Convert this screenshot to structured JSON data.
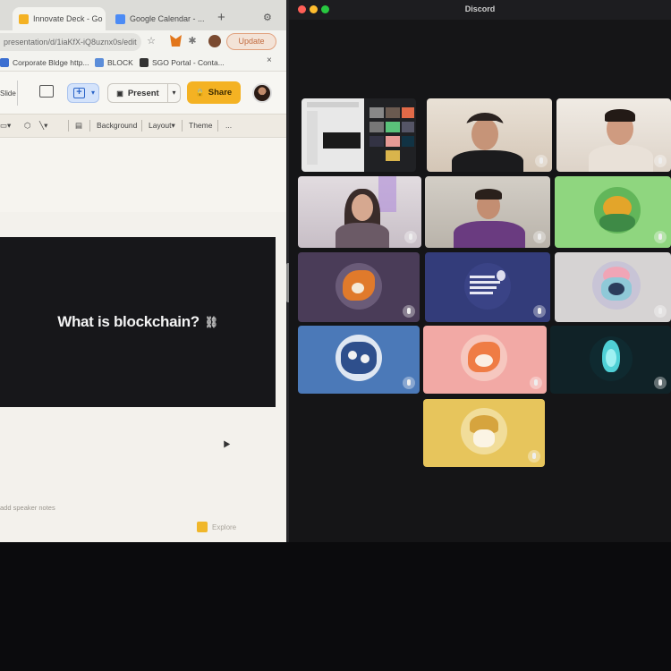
{
  "browser": {
    "tabs": [
      {
        "label": "Innovate Deck - Go",
        "active": true
      },
      {
        "label": "Google Calendar - ...",
        "active": false
      }
    ],
    "new_tab": "+",
    "url": "presentation/d/1iaKfX-iQ8uznx0s/edit",
    "update_label": "Update",
    "bookmarks": [
      "Corporate Bldge http...",
      "BLOCK",
      "SGO Portal - Conta..."
    ]
  },
  "slides": {
    "mode_label": "Slide",
    "present_label": "Present",
    "share_label": "Share",
    "format_items": [
      "Background",
      "Layout▾",
      "Theme",
      "..."
    ],
    "slide_title": "What is blockchain?",
    "chain_glyph": "⛓",
    "speaker_notes": "add speaker notes",
    "explore_label": "Explore"
  },
  "call": {
    "title": "Discord",
    "traffic_colors": [
      "#ff5f57",
      "#febc2e",
      "#28c840"
    ],
    "tiles": [
      {
        "name": "screen-share",
        "bg": "#dcdcdc"
      },
      {
        "name": "participant-woman-glasses",
        "bg": "#e6ddd2"
      },
      {
        "name": "participant-man-hoodie",
        "bg": "#ece5de"
      },
      {
        "name": "participant-woman-long-hair",
        "bg": "#d9d3d6"
      },
      {
        "name": "participant-man-purple",
        "bg": "#cfcac2"
      },
      {
        "name": "avatar-green-bird",
        "bg": "#8ed77f"
      },
      {
        "name": "avatar-orange-fox",
        "bg": "#4a3c58"
      },
      {
        "name": "avatar-navy-text",
        "bg": "#333c7a"
      },
      {
        "name": "avatar-pastel-character",
        "bg": "#d6d3d3"
      },
      {
        "name": "avatar-blue-sticker",
        "bg": "#4b79b8"
      },
      {
        "name": "avatar-pink-fox",
        "bg": "#f2a9a5"
      },
      {
        "name": "avatar-cyan-flame",
        "bg": "#102227"
      },
      {
        "name": "avatar-yellow-character",
        "bg": "#e7c55c"
      }
    ]
  }
}
